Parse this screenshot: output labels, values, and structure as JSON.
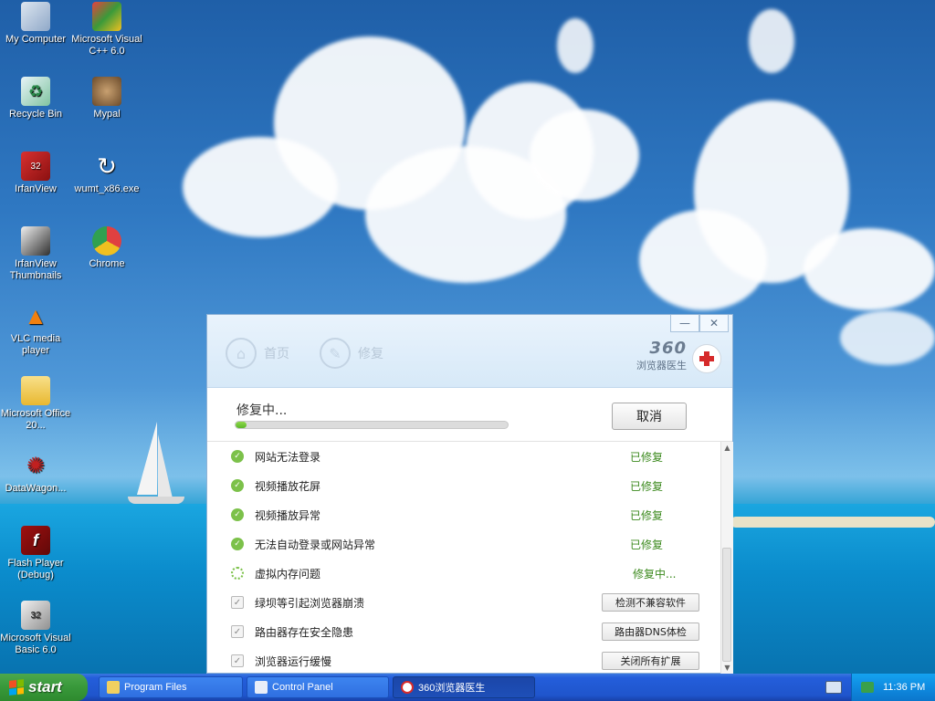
{
  "desktop": {
    "icons": [
      {
        "label": "My Computer",
        "icon": "computer-icon"
      },
      {
        "label": "Microsoft Visual C++ 6.0",
        "icon": "visual-cpp-icon"
      },
      {
        "label": "Recycle Bin",
        "icon": "recycle-bin-icon"
      },
      {
        "label": "Mypal",
        "icon": "mypal-icon"
      },
      {
        "label": "IrfanView",
        "icon": "irfanview-icon"
      },
      {
        "label": "wumt_x86.exe",
        "icon": "refresh-icon"
      },
      {
        "label": "IrfanView Thumbnails",
        "icon": "irfanview-thumbnails-icon"
      },
      {
        "label": "Chrome",
        "icon": "chrome-icon"
      },
      {
        "label": "VLC media player",
        "icon": "vlc-icon"
      },
      {
        "label": "Microsoft Office 20...",
        "icon": "folder-icon"
      },
      {
        "label": "DataWagon...",
        "icon": "datawagon-icon"
      },
      {
        "label": "Flash Player (Debug)",
        "icon": "flash-icon"
      },
      {
        "label": "Microsoft Visual Basic 6.0",
        "icon": "visual-basic-icon"
      }
    ]
  },
  "window": {
    "nav": {
      "home": "首页",
      "repair": "修复"
    },
    "brand": {
      "number": "360",
      "name": "浏览器医生"
    },
    "controls": {
      "minimize": "—",
      "close": "✕"
    },
    "status": {
      "title": "修复中...",
      "progress": 0.04
    },
    "cancel_label": "取消",
    "items": [
      {
        "text": "网站无法登录",
        "status": "已修复",
        "kind": "ok"
      },
      {
        "text": "视频播放花屏",
        "status": "已修复",
        "kind": "ok"
      },
      {
        "text": "视频播放异常",
        "status": "已修复",
        "kind": "ok"
      },
      {
        "text": "无法自动登录或网站异常",
        "status": "已修复",
        "kind": "ok"
      },
      {
        "text": "虚拟内存问题",
        "status": "修复中...",
        "kind": "spin"
      },
      {
        "text": "绿坝等引起浏览器崩溃",
        "action": "检测不兼容软件",
        "kind": "chk"
      },
      {
        "text": "路由器存在安全隐患",
        "action": "路由器DNS体检",
        "kind": "chk"
      },
      {
        "text": "浏览器运行缓慢",
        "action": "关闭所有扩展",
        "kind": "chk"
      }
    ]
  },
  "taskbar": {
    "start_label": "start",
    "buttons": [
      {
        "label": "Program Files",
        "icon": "folder-icon"
      },
      {
        "label": "Control Panel",
        "icon": "control-panel-icon"
      },
      {
        "label": "360浏览器医生",
        "icon": "360-doctor-icon",
        "active": true
      }
    ],
    "clock": "11:36 PM"
  }
}
